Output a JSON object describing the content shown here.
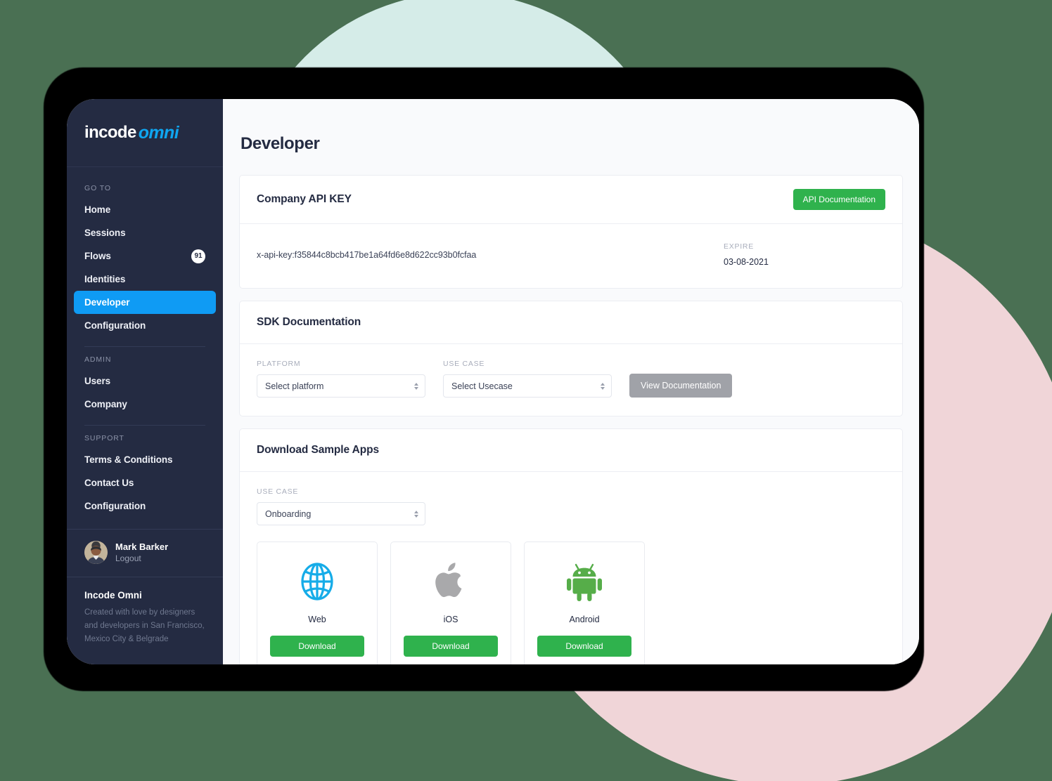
{
  "theme": {
    "background": "#4a7053",
    "teal_blob": "#d5ece8",
    "pink_blob": "#f0d5d8",
    "sidebar_bg": "#242b42",
    "accent_blue": "#0f9bf4",
    "accent_green": "#2fb24d",
    "grey_button": "#a0a2a8"
  },
  "sidebar": {
    "brand": {
      "part1": "incode",
      "part2": "omni"
    },
    "sections": [
      {
        "heading": "GO TO",
        "items": [
          {
            "label": "Home",
            "badge": null,
            "active": false
          },
          {
            "label": "Sessions",
            "badge": null,
            "active": false
          },
          {
            "label": "Flows",
            "badge": "91",
            "active": false
          },
          {
            "label": "Identities",
            "badge": null,
            "active": false
          },
          {
            "label": "Developer",
            "badge": null,
            "active": true
          },
          {
            "label": "Configuration",
            "badge": null,
            "active": false
          }
        ]
      },
      {
        "heading": "ADMIN",
        "items": [
          {
            "label": "Users",
            "badge": null,
            "active": false
          },
          {
            "label": "Company",
            "badge": null,
            "active": false
          }
        ]
      },
      {
        "heading": "SUPPORT",
        "items": [
          {
            "label": "Terms & Conditions",
            "badge": null,
            "active": false
          },
          {
            "label": "Contact Us",
            "badge": null,
            "active": false
          },
          {
            "label": "Configuration",
            "badge": null,
            "active": false
          }
        ]
      }
    ],
    "user": {
      "name": "Mark Barker",
      "logout_label": "Logout"
    },
    "footer": {
      "title": "Incode Omni",
      "text": "Created with love by designers and developers in San Francisco, Mexico City & Belgrade"
    }
  },
  "main": {
    "page_title": "Developer",
    "api_key_card": {
      "title": "Company API KEY",
      "doc_button": "API Documentation",
      "key_value": "x-api-key:f35844c8bcb417be1a64fd6e8d622cc93b0fcfaa",
      "expire_label": "EXPIRE",
      "expire_value": "03-08-2021"
    },
    "sdk_card": {
      "title": "SDK Documentation",
      "platform_label": "PLATFORM",
      "platform_value": "Select platform",
      "usecase_label": "USE CASE",
      "usecase_value": "Select Usecase",
      "view_button": "View Documentation"
    },
    "download_card": {
      "title": "Download Sample Apps",
      "usecase_label": "USE CASE",
      "usecase_value": "Onboarding",
      "apps": [
        {
          "name": "Web",
          "icon": "globe-icon",
          "button": "Download"
        },
        {
          "name": "iOS",
          "icon": "apple-icon",
          "button": "Download"
        },
        {
          "name": "Android",
          "icon": "android-icon",
          "button": "Download"
        }
      ]
    }
  }
}
